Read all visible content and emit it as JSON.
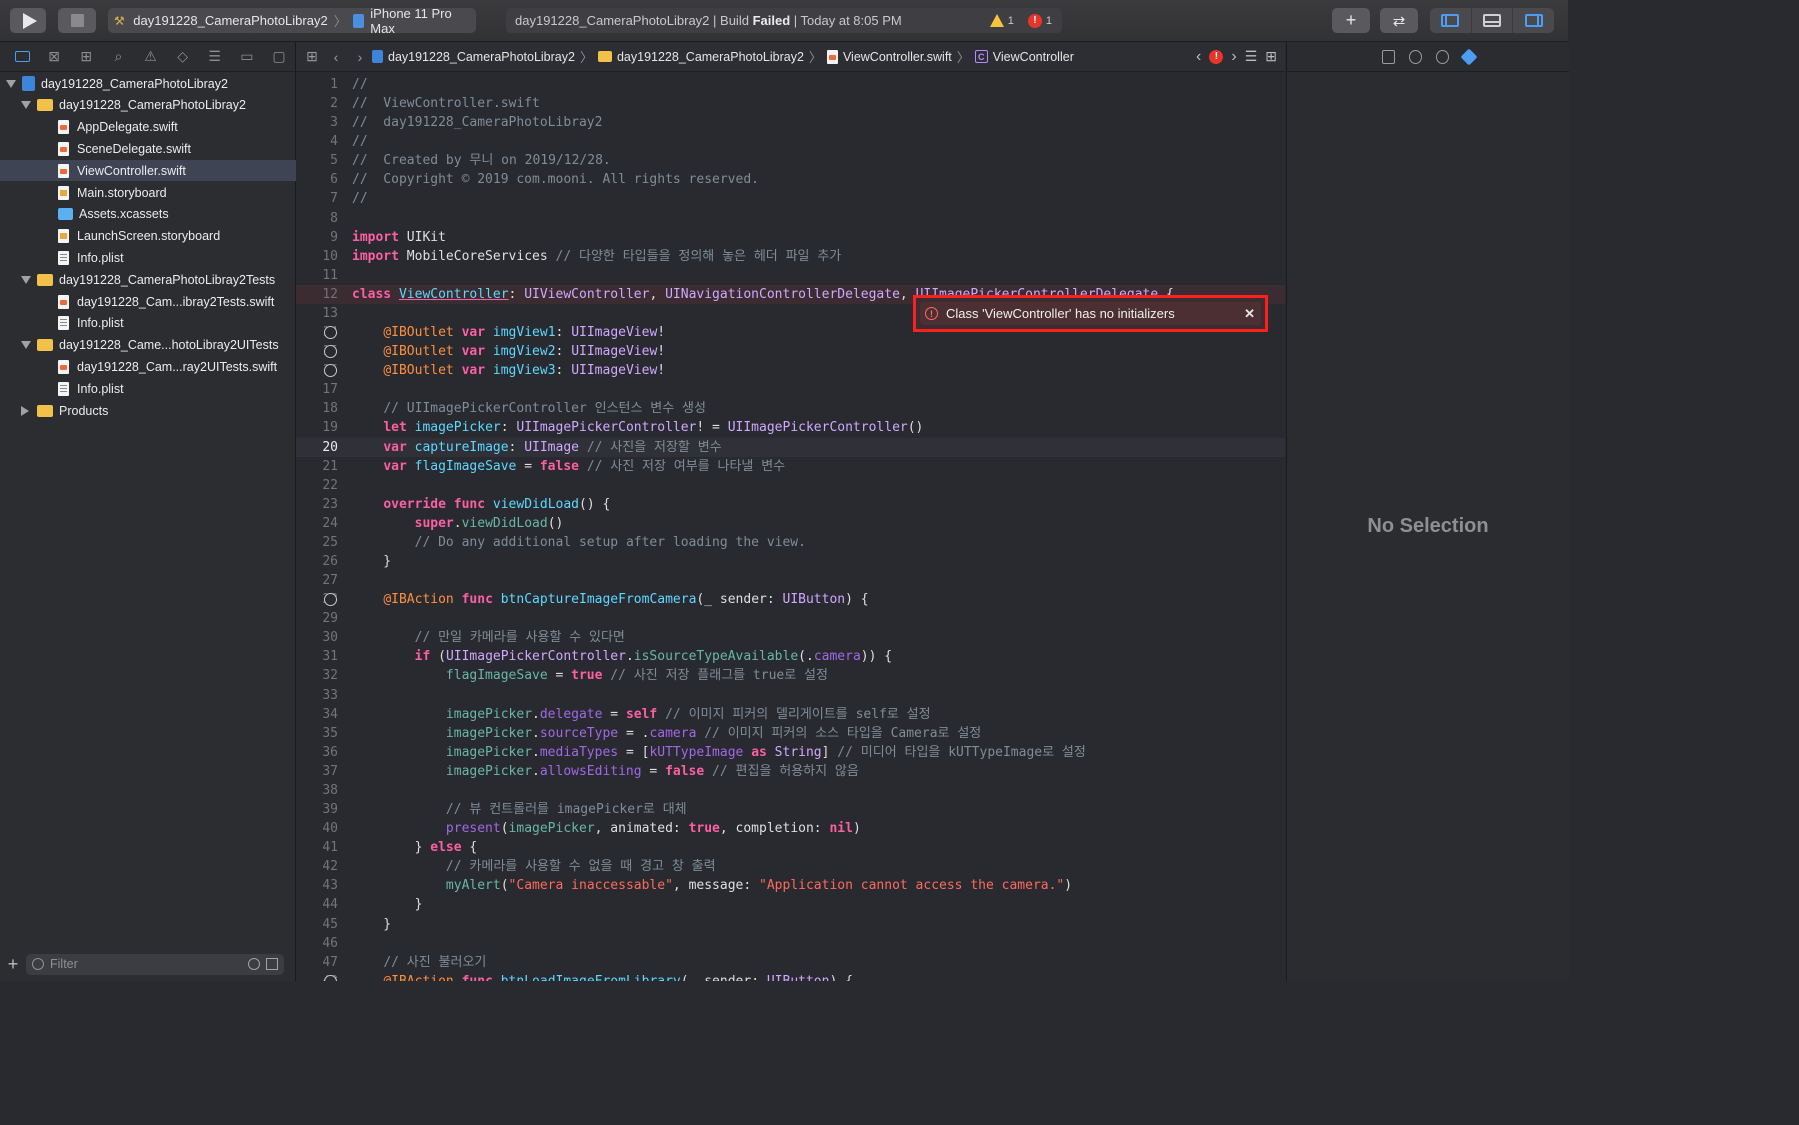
{
  "toolbar": {
    "scheme_name": "day191228_CameraPhotoLibray2",
    "device_name": "iPhone 11 Pro Max",
    "activity_project": "day191228_CameraPhotoLibray2",
    "activity_build": "Build",
    "activity_result": "Failed",
    "activity_time": "Today at 8:05 PM",
    "warning_count": "1",
    "error_count": "1",
    "add_label": "+"
  },
  "navigator": {
    "tree": [
      {
        "label": "day191228_CameraPhotoLibray2",
        "type": "project",
        "expanded": true
      },
      {
        "label": "day191228_CameraPhotoLibray2",
        "type": "folder",
        "expanded": true
      },
      {
        "label": "AppDelegate.swift",
        "type": "swift"
      },
      {
        "label": "SceneDelegate.swift",
        "type": "swift"
      },
      {
        "label": "ViewController.swift",
        "type": "swift",
        "selected": true
      },
      {
        "label": "Main.storyboard",
        "type": "storyboard"
      },
      {
        "label": "Assets.xcassets",
        "type": "assets"
      },
      {
        "label": "LaunchScreen.storyboard",
        "type": "storyboard"
      },
      {
        "label": "Info.plist",
        "type": "plist"
      },
      {
        "label": "day191228_CameraPhotoLibray2Tests",
        "type": "folder",
        "expanded": true
      },
      {
        "label": "day191228_Cam...ibray2Tests.swift",
        "type": "swift"
      },
      {
        "label": "Info.plist",
        "type": "plist"
      },
      {
        "label": "day191228_Came...hotoLibray2UITests",
        "type": "folder",
        "expanded": true
      },
      {
        "label": "day191228_Cam...ray2UITests.swift",
        "type": "swift"
      },
      {
        "label": "Info.plist",
        "type": "plist"
      },
      {
        "label": "Products",
        "type": "folder",
        "expanded": false
      }
    ],
    "filter_placeholder": "Filter"
  },
  "jumpbar": {
    "crumb_project": "day191228_CameraPhotoLibray2",
    "crumb_folder": "day191228_CameraPhotoLibray2",
    "crumb_file": "ViewController.swift",
    "crumb_symbol": "ViewController"
  },
  "editor": {
    "current_line": 20,
    "error_message": "Class 'ViewController' has no initializers",
    "lines": [
      [
        [
          "cm",
          "//"
        ]
      ],
      [
        [
          "cm",
          "//  ViewController.swift"
        ]
      ],
      [
        [
          "cm",
          "//  day191228_CameraPhotoLibray2"
        ]
      ],
      [
        [
          "cm",
          "//"
        ]
      ],
      [
        [
          "cm",
          "//  Created by 무니 on 2019/12/28."
        ]
      ],
      [
        [
          "cm",
          "//  Copyright © 2019 com.mooni. All rights reserved."
        ]
      ],
      [
        [
          "cm",
          "//"
        ]
      ],
      [],
      [
        [
          "kw",
          "import"
        ],
        [
          "pl",
          " UIKit"
        ]
      ],
      [
        [
          "kw",
          "import"
        ],
        [
          "pl",
          " MobileCoreServices "
        ],
        [
          "cm",
          "// 다양한 타입들을 정의해 놓은 헤더 파일 추가"
        ]
      ],
      [],
      [
        [
          "kw",
          "class"
        ],
        [
          "pl",
          " "
        ],
        [
          "dc ul",
          "ViewController"
        ],
        [
          "pl",
          ": "
        ],
        [
          "ty",
          "UIViewController"
        ],
        [
          "pl",
          ", "
        ],
        [
          "ty",
          "UINavigationControllerDelegate"
        ],
        [
          "pl",
          ", "
        ],
        [
          "ty",
          "UIImagePickerControllerDelegate"
        ],
        [
          "pl",
          " {"
        ]
      ],
      [],
      [
        [
          "pl",
          "    "
        ],
        [
          "at",
          "@IBOutlet"
        ],
        [
          "pl",
          " "
        ],
        [
          "kw",
          "var"
        ],
        [
          "pl",
          " "
        ],
        [
          "dc",
          "imgView1"
        ],
        [
          "pl",
          ": "
        ],
        [
          "ty",
          "UIImageView"
        ],
        [
          "pl",
          "!"
        ]
      ],
      [
        [
          "pl",
          "    "
        ],
        [
          "at",
          "@IBOutlet"
        ],
        [
          "pl",
          " "
        ],
        [
          "kw",
          "var"
        ],
        [
          "pl",
          " "
        ],
        [
          "dc",
          "imgView2"
        ],
        [
          "pl",
          ": "
        ],
        [
          "ty",
          "UIImageView"
        ],
        [
          "pl",
          "!"
        ]
      ],
      [
        [
          "pl",
          "    "
        ],
        [
          "at",
          "@IBOutlet"
        ],
        [
          "pl",
          " "
        ],
        [
          "kw",
          "var"
        ],
        [
          "pl",
          " "
        ],
        [
          "dc",
          "imgView3"
        ],
        [
          "pl",
          ": "
        ],
        [
          "ty",
          "UIImageView"
        ],
        [
          "pl",
          "!"
        ]
      ],
      [],
      [
        [
          "pl",
          "    "
        ],
        [
          "cm",
          "// UIImagePickerController 인스턴스 변수 생성"
        ]
      ],
      [
        [
          "pl",
          "    "
        ],
        [
          "kw",
          "let"
        ],
        [
          "pl",
          " "
        ],
        [
          "dc",
          "imagePicker"
        ],
        [
          "pl",
          ": "
        ],
        [
          "ty",
          "UIImagePickerController"
        ],
        [
          "pl",
          "! = "
        ],
        [
          "ty",
          "UIImagePickerController"
        ],
        [
          "pl",
          "()"
        ]
      ],
      [
        [
          "pl",
          "    "
        ],
        [
          "kw",
          "var"
        ],
        [
          "pl",
          " "
        ],
        [
          "dc",
          "captureImage"
        ],
        [
          "pl",
          ": "
        ],
        [
          "ty",
          "UIImage"
        ],
        [
          "pl",
          " "
        ],
        [
          "cm",
          "// 사진을 저장할 변수"
        ]
      ],
      [
        [
          "pl",
          "    "
        ],
        [
          "kw",
          "var"
        ],
        [
          "pl",
          " "
        ],
        [
          "dc",
          "flagImageSave"
        ],
        [
          "pl",
          " = "
        ],
        [
          "kw",
          "false"
        ],
        [
          "pl",
          " "
        ],
        [
          "cm",
          "// 사진 저장 여부를 나타낼 변수"
        ]
      ],
      [],
      [
        [
          "pl",
          "    "
        ],
        [
          "kw",
          "override"
        ],
        [
          "pl",
          " "
        ],
        [
          "kw",
          "func"
        ],
        [
          "pl",
          " "
        ],
        [
          "dc",
          "viewDidLoad"
        ],
        [
          "pl",
          "() {"
        ]
      ],
      [
        [
          "pl",
          "        "
        ],
        [
          "kw",
          "super"
        ],
        [
          "pl",
          "."
        ],
        [
          "fn",
          "viewDidLoad"
        ],
        [
          "pl",
          "()"
        ]
      ],
      [
        [
          "pl",
          "        "
        ],
        [
          "cm",
          "// Do any additional setup after loading the view."
        ]
      ],
      [
        [
          "pl",
          "    }"
        ]
      ],
      [],
      [
        [
          "pl",
          "    "
        ],
        [
          "at",
          "@IBAction"
        ],
        [
          "pl",
          " "
        ],
        [
          "kw",
          "func"
        ],
        [
          "pl",
          " "
        ],
        [
          "dc",
          "btnCaptureImageFromCamera"
        ],
        [
          "pl",
          "(_ sender: "
        ],
        [
          "ty",
          "UIButton"
        ],
        [
          "pl",
          ") {"
        ]
      ],
      [],
      [
        [
          "pl",
          "        "
        ],
        [
          "cm",
          "// 만일 카메라를 사용할 수 있다면"
        ]
      ],
      [
        [
          "pl",
          "        "
        ],
        [
          "kw",
          "if"
        ],
        [
          "pl",
          " ("
        ],
        [
          "ty",
          "UIImagePickerController"
        ],
        [
          "pl",
          "."
        ],
        [
          "fn",
          "isSourceTypeAvailable"
        ],
        [
          "pl",
          "(."
        ],
        [
          "it",
          "camera"
        ],
        [
          "pl",
          ")) {"
        ]
      ],
      [
        [
          "pl",
          "            "
        ],
        [
          "fn",
          "flagImageSave"
        ],
        [
          "pl",
          " = "
        ],
        [
          "kw",
          "true"
        ],
        [
          "pl",
          " "
        ],
        [
          "cm",
          "// 사진 저장 플래그를 true로 설정"
        ]
      ],
      [],
      [
        [
          "pl",
          "            "
        ],
        [
          "fn",
          "imagePicker"
        ],
        [
          "pl",
          "."
        ],
        [
          "it",
          "delegate"
        ],
        [
          "pl",
          " = "
        ],
        [
          "kw",
          "self"
        ],
        [
          "pl",
          " "
        ],
        [
          "cm",
          "// 이미지 피커의 델리게이트를 self로 설정"
        ]
      ],
      [
        [
          "pl",
          "            "
        ],
        [
          "fn",
          "imagePicker"
        ],
        [
          "pl",
          "."
        ],
        [
          "it",
          "sourceType"
        ],
        [
          "pl",
          " = ."
        ],
        [
          "it",
          "camera"
        ],
        [
          "pl",
          " "
        ],
        [
          "cm",
          "// 이미지 피커의 소스 타입을 Camera로 설정"
        ]
      ],
      [
        [
          "pl",
          "            "
        ],
        [
          "fn",
          "imagePicker"
        ],
        [
          "pl",
          "."
        ],
        [
          "it",
          "mediaTypes"
        ],
        [
          "pl",
          " = ["
        ],
        [
          "it",
          "kUTTypeImage"
        ],
        [
          "pl",
          " "
        ],
        [
          "kw",
          "as"
        ],
        [
          "pl",
          " "
        ],
        [
          "ty",
          "String"
        ],
        [
          "pl",
          "] "
        ],
        [
          "cm",
          "// 미디어 타입을 kUTTypeImage로 설정"
        ]
      ],
      [
        [
          "pl",
          "            "
        ],
        [
          "fn",
          "imagePicker"
        ],
        [
          "pl",
          "."
        ],
        [
          "it",
          "allowsEditing"
        ],
        [
          "pl",
          " = "
        ],
        [
          "kw",
          "false"
        ],
        [
          "pl",
          " "
        ],
        [
          "cm",
          "// 편집을 허용하지 않음"
        ]
      ],
      [],
      [
        [
          "pl",
          "            "
        ],
        [
          "cm",
          "// 뷰 컨트롤러를 imagePicker로 대체"
        ]
      ],
      [
        [
          "pl",
          "            "
        ],
        [
          "it",
          "present"
        ],
        [
          "pl",
          "("
        ],
        [
          "fn",
          "imagePicker"
        ],
        [
          "pl",
          ", animated: "
        ],
        [
          "kw",
          "true"
        ],
        [
          "pl",
          ", completion: "
        ],
        [
          "kw",
          "nil"
        ],
        [
          "pl",
          ")"
        ]
      ],
      [
        [
          "pl",
          "        } "
        ],
        [
          "kw",
          "else"
        ],
        [
          "pl",
          " {"
        ]
      ],
      [
        [
          "pl",
          "            "
        ],
        [
          "cm",
          "// 카메라를 사용할 수 없을 때 경고 창 출력"
        ]
      ],
      [
        [
          "pl",
          "            "
        ],
        [
          "fn",
          "myAlert"
        ],
        [
          "pl",
          "("
        ],
        [
          "st",
          "\"Camera inaccessable\""
        ],
        [
          "pl",
          ", message: "
        ],
        [
          "st",
          "\"Application cannot access the camera.\""
        ],
        [
          "pl",
          ")"
        ]
      ],
      [
        [
          "pl",
          "        }"
        ]
      ],
      [
        [
          "pl",
          "    }"
        ]
      ],
      [],
      [
        [
          "pl",
          "    "
        ],
        [
          "cm",
          "// 사진 불러오기"
        ]
      ],
      [
        [
          "pl",
          "    "
        ],
        [
          "at",
          "@IBAction"
        ],
        [
          "pl",
          " "
        ],
        [
          "kw",
          "func"
        ],
        [
          "pl",
          " "
        ],
        [
          "dc",
          "btnLoadImageFromLibrary"
        ],
        [
          "pl",
          "(_ sender: "
        ],
        [
          "ty",
          "UIButton"
        ],
        [
          "pl",
          ") {"
        ]
      ]
    ]
  },
  "inspector": {
    "empty_label": "No Selection"
  }
}
